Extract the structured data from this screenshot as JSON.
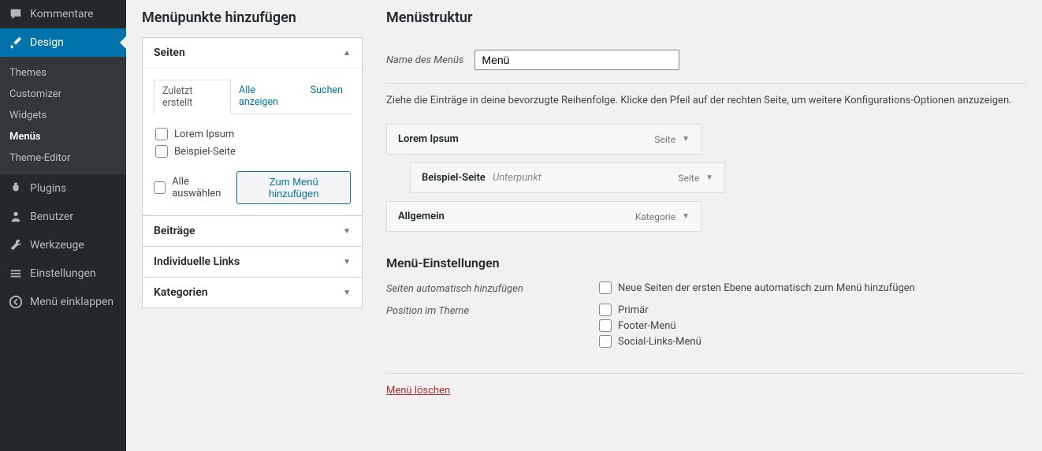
{
  "sidebar": {
    "comments": "Kommentare",
    "design": "Design",
    "submenu": [
      "Themes",
      "Customizer",
      "Widgets",
      "Menüs",
      "Theme-Editor"
    ],
    "plugins": "Plugins",
    "users": "Benutzer",
    "tools": "Werkzeuge",
    "settings": "Einstellungen",
    "collapse": "Menü einklappen"
  },
  "left": {
    "title": "Menüpunkte hinzufügen",
    "panels": {
      "pages": "Seiten",
      "posts": "Beiträge",
      "custom_links": "Individuelle Links",
      "categories": "Kategorien"
    },
    "tabs": {
      "recent": "Zuletzt erstellt",
      "view_all": "Alle anzeigen",
      "search": "Suchen"
    },
    "items": [
      "Lorem Ipsum",
      "Beispiel-Seite"
    ],
    "select_all": "Alle auswählen",
    "add_button": "Zum Menü hinzufügen"
  },
  "right": {
    "title": "Menüstruktur",
    "name_label": "Name des Menüs",
    "name_value": "Menü",
    "hint": "Ziehe die Einträge in deine bevorzugte Reihenfolge. Klicke den Pfeil auf der rechten Seite, um weitere Konfigurations-Optionen anzuzeigen.",
    "menu_items": [
      {
        "title": "Lorem Ipsum",
        "sub": "",
        "type": "Seite",
        "indent": false
      },
      {
        "title": "Beispiel-Seite",
        "sub": "Unterpunkt",
        "type": "Seite",
        "indent": true
      },
      {
        "title": "Allgemein",
        "sub": "",
        "type": "Kategorie",
        "indent": false
      }
    ],
    "settings_title": "Menü-Einstellungen",
    "auto_add_label": "Seiten automatisch hinzufügen",
    "auto_add_option": "Neue Seiten der ersten Ebene automatisch zum Menü hinzufügen",
    "location_label": "Position im Theme",
    "locations": [
      "Primär",
      "Footer-Menü",
      "Social-Links-Menü"
    ],
    "delete": "Menü löschen"
  }
}
